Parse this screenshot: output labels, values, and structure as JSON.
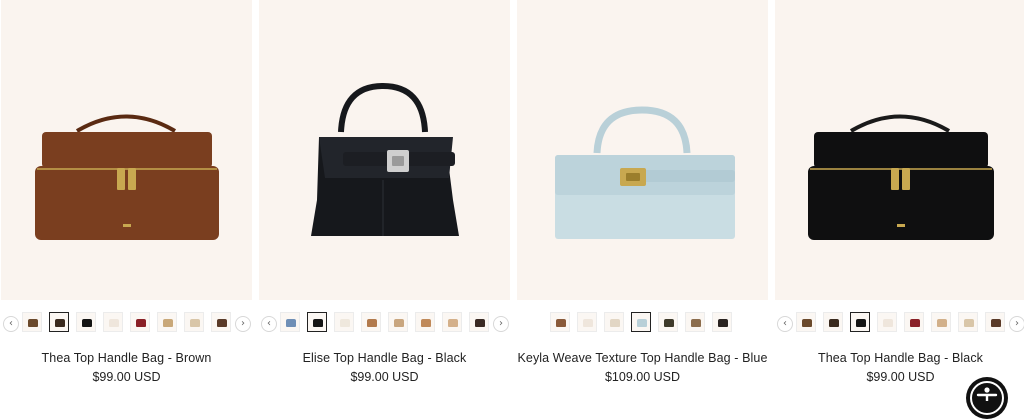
{
  "products": [
    {
      "title": "Thea Top Handle Bag - Brown",
      "price": "$99.00 USD",
      "bag_color": "#7a3e1f",
      "selected_swatch": 1,
      "swatches": [
        "#6b4a2c",
        "#3a2a1e",
        "#141414",
        "#efe6dc",
        "#8a2027",
        "#c9a879",
        "#d9c6a8",
        "#5a3a28"
      ]
    },
    {
      "title": "Elise Top Handle Bag - Black",
      "price": "$99.00 USD",
      "bag_color": "#16181c",
      "selected_swatch": 1,
      "swatches": [
        "#6f8fb6",
        "#151515",
        "#efe8dd",
        "#b27a4c",
        "#c9a67f",
        "#c08a5a",
        "#d4b08a",
        "#3a2a24"
      ]
    },
    {
      "title": "Keyla Weave Texture Top Handle Bag - Blue",
      "price": "$109.00 USD",
      "bag_color": "#c9dde3",
      "selected_swatch": 3,
      "swatches": [
        "#8a5a3a",
        "#efe6dc",
        "#e2d6c4",
        "#b9d0d8",
        "#3e3a2a",
        "#8c6d4d",
        "#2a2320"
      ]
    },
    {
      "title": "Thea Top Handle Bag - Black",
      "price": "$99.00 USD",
      "bag_color": "#0f0f10",
      "selected_swatch": 2,
      "swatches": [
        "#6b4a2c",
        "#3a2a1e",
        "#141414",
        "#efe6dc",
        "#8a2027",
        "#d2b08a",
        "#d9c6a8",
        "#5a3a28"
      ]
    }
  ],
  "colors": {
    "hardware_gold": "#c8a850",
    "card_bg": "#faf4ef"
  },
  "icons": {
    "prev": "chevron-left-icon",
    "next": "chevron-right-icon",
    "accessibility": "accessibility-icon"
  },
  "arrows": {
    "prev_glyph": "‹",
    "next_glyph": "›"
  }
}
